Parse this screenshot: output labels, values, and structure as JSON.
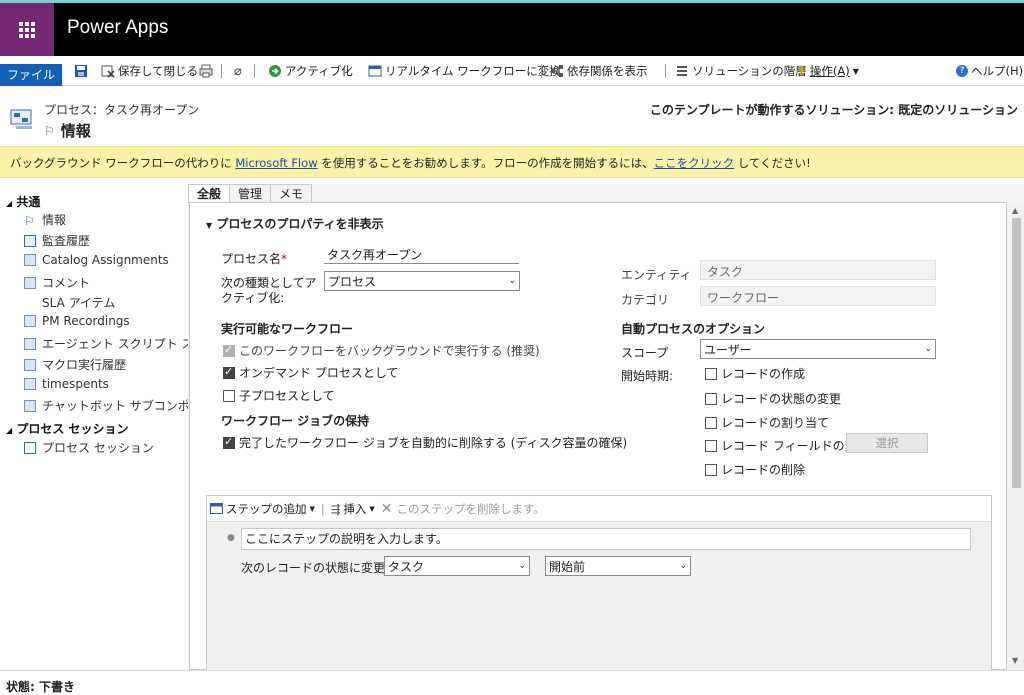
{
  "app": {
    "title": "Power Apps"
  },
  "toolbar": {
    "file": "ファイル",
    "save_close": "保存して閉じる",
    "activate": "アクティブ化",
    "convert": "リアルタイム ワークフローに変換",
    "dependencies": "依存関係を表示",
    "layers": "ソリューションの階層",
    "actions": "操作(A)",
    "help": "ヘルプ(H)"
  },
  "header": {
    "breadcrumb": "プロセス：タスク再オープン",
    "title": "情報",
    "solution": "このテンプレートが動作するソリューション: 既定のソリューション"
  },
  "banner": {
    "prefix": "バックグラウンド ワークフローの代わりに",
    "link1": "Microsoft Flow",
    "middle": "を使用することをお勧めします。フローの作成を開始するには、",
    "link2": "ここをクリック",
    "suffix": "してください!"
  },
  "nav": {
    "group_common": "共通",
    "items": [
      "情報",
      "監査履歴",
      "Catalog Assignments",
      "コメント",
      "SLA アイテム",
      "PM Recordings",
      "エージェント スクリプト ス…",
      "マクロ実行履歴",
      "timespents",
      "チャットボット サブコンポ…"
    ],
    "group_session": "プロセス セッション",
    "session_item": "プロセス セッション"
  },
  "tabs": [
    "全般",
    "管理",
    "メモ"
  ],
  "form": {
    "section_title": "プロセスのプロパティを非表示",
    "process_name_label": "プロセス名",
    "required_mark": "*",
    "process_name_value": "タスク再オープン",
    "activate_as_label": "次の種類としてアクティブ化:",
    "activate_as_value": "プロセス",
    "entity_label": "エンティティ",
    "entity_value": "タスク",
    "category_label": "カテゴリ",
    "category_value": "ワークフロー",
    "available_workflow": "実行可能なワークフロー",
    "run_background": "このワークフローをバックグラウンドで実行する (推奨)",
    "on_demand": "オンデマンド プロセスとして",
    "child_process": "子プロセスとして",
    "retention_title": "ワークフロー ジョブの保持",
    "auto_delete": "完了したワークフロー ジョブを自動的に削除する (ディスク容量の確保)",
    "auto_options_title": "自動プロセスのオプション",
    "scope_label": "スコープ",
    "scope_value": "ユーザー",
    "start_when_label": "開始時期:",
    "start_options": [
      "レコードの作成",
      "レコードの状態の変更",
      "レコードの割り当て",
      "レコード フィールドの変更",
      "レコードの削除"
    ],
    "select_button": "選択"
  },
  "steps": {
    "add_step": "ステップの追加",
    "insert": "挿入",
    "delete": "このステップを削除します。",
    "description": "ここにステップの説明を入力します。",
    "change_status_label": "次のレコードの状態に変更:",
    "entity": "タスク",
    "status": "開始前"
  },
  "status_bar": {
    "text": "状態: 下書き"
  }
}
